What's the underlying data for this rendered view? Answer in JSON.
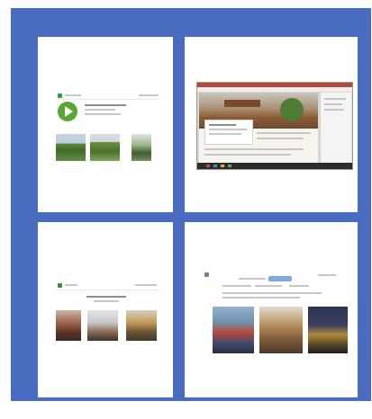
{
  "slide": {
    "background_color": "#4a6cc0",
    "card_color": "#ffffff"
  },
  "cards": [
    {
      "name": "app-store-listing",
      "icon": "play-arrow-icon",
      "photos": [
        "green-hills-photo",
        "mountain-photo",
        "tree-photo"
      ]
    },
    {
      "name": "desktop-browser-screenshot",
      "icon": "browser-window-icon"
    },
    {
      "name": "photo-gallery-page",
      "photos": [
        "red-building-photo",
        "white-building-photo",
        "balloon-photo"
      ]
    },
    {
      "name": "search-results-page",
      "photos": [
        "car-street-photo",
        "old-street-photo",
        "night-street-photo"
      ]
    }
  ],
  "footer": {
    "left_text": "",
    "page_number": ""
  }
}
